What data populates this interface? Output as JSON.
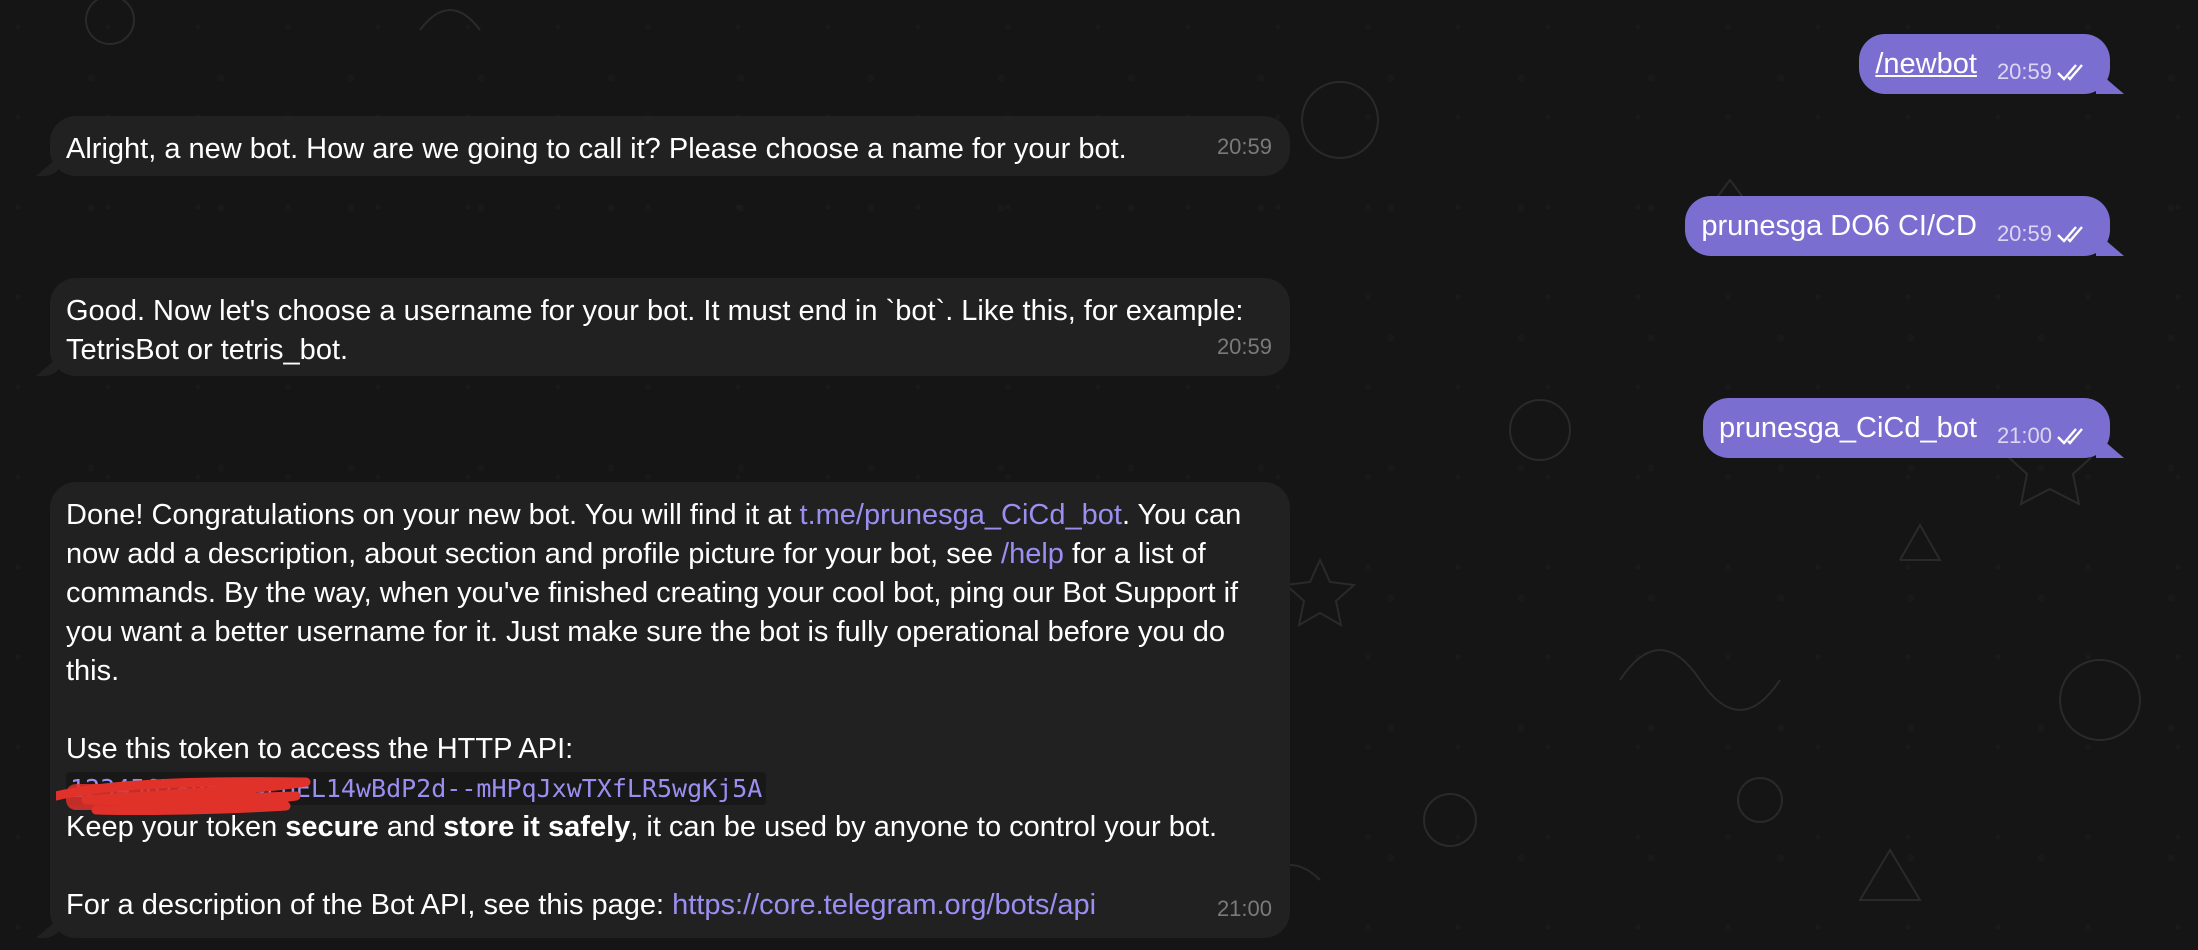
{
  "incoming": [
    {
      "text": "Alright, a new bot. How are we going to call it? Please choose a name for your bot.",
      "time": "20:59"
    },
    {
      "text": "Good. Now let's choose a username for your bot. It must end in `bot`. Like this, for example: TetrisBot or tetris_bot.",
      "time": "20:59"
    },
    {
      "p1_a": "Done! Congratulations on your new bot. You will find it at ",
      "p1_link": "t.me/prunesga_CiCd_bot",
      "p1_b": ". You can now add a description, about section and profile picture for your bot, see ",
      "p1_cmd": "/help",
      "p1_c": " for a list of commands. By the way, when you've finished creating your cool bot, ping our Bot Support if you want a better username for it. Just make sure the bot is fully operational before you do this.",
      "token_intro": "Use this token to access the HTTP API:",
      "token_hidden": "1234567895",
      "token": ":AAFoEL14wBdP2d--mHPqJxwTXfLR5wgKj5A",
      "warn_a": "Keep your token ",
      "warn_bold1": "secure",
      "warn_b": " and ",
      "warn_bold2": "store it safely",
      "warn_c": ", it can be used by anyone to control your bot.",
      "desc": "For a description of the Bot API, see this page: ",
      "desc_link": "https://core.telegram.org/bots/api",
      "time": "21:00"
    }
  ],
  "outgoing": [
    {
      "text": "/newbot",
      "time": "20:59"
    },
    {
      "text": "prunesga DO6 CI/CD",
      "time": "20:59"
    },
    {
      "text": "prunesga_CiCd_bot",
      "time": "21:00"
    }
  ],
  "colors": {
    "outgoing_bubble": "#7a6fd0",
    "incoming_bubble": "#212121",
    "link": "#9a8ff0",
    "background": "#151515"
  }
}
